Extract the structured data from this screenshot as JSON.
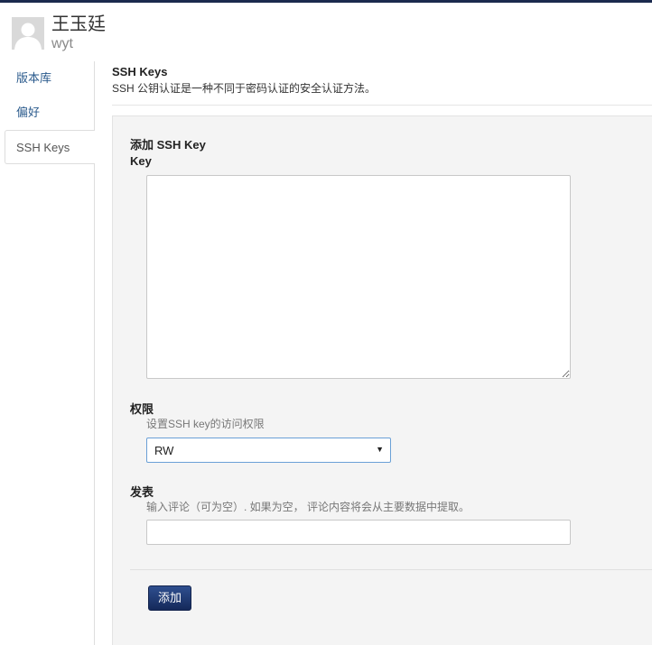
{
  "user": {
    "display_name": "王玉廷",
    "login": "wyt"
  },
  "sidebar": {
    "items": [
      {
        "label": "版本库",
        "active": false
      },
      {
        "label": "偏好",
        "active": false
      },
      {
        "label": "SSH Keys",
        "active": true
      }
    ]
  },
  "section": {
    "title": "SSH Keys",
    "description": "SSH 公钥认证是一种不同于密码认证的安全认证方法。"
  },
  "form": {
    "title": "添加 SSH Key",
    "key_label": "Key",
    "key_value": "",
    "permission": {
      "label": "权限",
      "help": "设置SSH key的访问权限",
      "selected": "RW"
    },
    "comment": {
      "label": "发表",
      "help": "输入评论（可为空）. 如果为空， 评论内容将会从主要数据中提取。",
      "value": ""
    },
    "submit_label": "添加"
  },
  "colors": {
    "top_bar": "#1b2a4e",
    "link": "#2a5a8c",
    "primary_button": "#1f3a73",
    "panel_background": "#f4f4f4",
    "select_border": "#6aa0d6"
  },
  "icons": {
    "avatar": "default-user-avatar-icon",
    "select_arrow": "triangle-down-icon"
  }
}
